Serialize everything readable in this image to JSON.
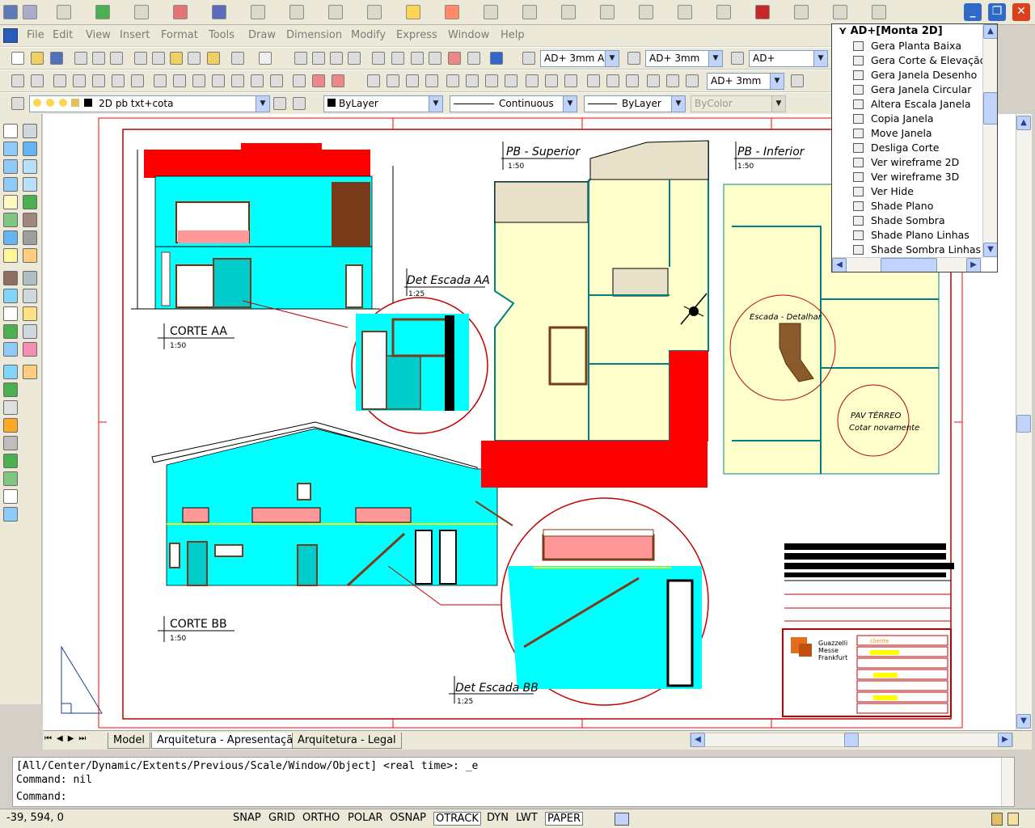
{
  "menubar": {
    "items": [
      "File",
      "Edit",
      "View",
      "Insert",
      "Format",
      "Tools",
      "Draw",
      "Dimension",
      "Modify",
      "Express",
      "Window",
      "Help"
    ]
  },
  "toolbar_styles": {
    "text_style": "AD+ 3mm A",
    "dim_style": "AD+ 3mm",
    "table_style": "AD+"
  },
  "toolbar_dim": {
    "dim_style": "AD+ 3mm"
  },
  "layers": {
    "current_layer": "2D pb txt+cota",
    "color": "ByLayer",
    "linetype": "Continuous",
    "lineweight": "ByLayer",
    "plotstyle": "ByColor"
  },
  "popup": {
    "title": "AD+[Monta 2D]",
    "items": [
      "Gera Planta Baixa",
      "Gera Corte & Elevação",
      "Gera Janela Desenho",
      "Gera Janela Circular",
      "Altera Escala Janela",
      "Copia Janela",
      "Move Janela",
      "Desliga Corte",
      "Ver wireframe 2D",
      "Ver wireframe 3D",
      "Ver Hide",
      "Shade Plano",
      "Shade Sombra",
      "Shade Plano Linhas",
      "Shade Sombra Linhas"
    ]
  },
  "drawing": {
    "corte_aa": "CORTE AA",
    "corte_aa_scale": "1:50",
    "corte_bb": "CORTE BB",
    "corte_bb_scale": "1:50",
    "det_aa": "Det Escada AA",
    "det_aa_scale": "1:25",
    "det_bb": "Det Escada BB",
    "det_bb_scale": "1:25",
    "pb_sup": "PB - Superior",
    "pb_sup_scale": "1:50",
    "pb_inf": "PB - Inferior",
    "pb_inf_scale": "1:50",
    "escada_detalhar": "Escada - Detalhar",
    "pav_terreo": "PAV TÉRREO",
    "cotar": "Cotar novamente",
    "logo_line1": "Guazzelli",
    "logo_line2": "Messe",
    "logo_line3": "Frankfurt",
    "cliente": "cliente"
  },
  "tabs": [
    "Model",
    "Arquitetura - Apresentação",
    "Arquitetura - Legal"
  ],
  "active_tab": "Arquitetura - Apresentação",
  "command": {
    "line1": "[All/Center/Dynamic/Extents/Previous/Scale/Window/Object] <real time>: _e",
    "line2": "Command: nil",
    "prompt": "Command:"
  },
  "status": {
    "coords": "-39, 594, 0",
    "toggles": [
      "SNAP",
      "GRID",
      "ORTHO",
      "POLAR",
      "OSNAP",
      "OTRACK",
      "DYN",
      "LWT",
      "PAPER"
    ],
    "active_toggles": [
      "OTRACK",
      "PAPER"
    ]
  },
  "colors": {
    "cyan": "#00ffff",
    "red": "#ff0000",
    "cream": "#ffffcc",
    "border_red": "#c00000"
  }
}
